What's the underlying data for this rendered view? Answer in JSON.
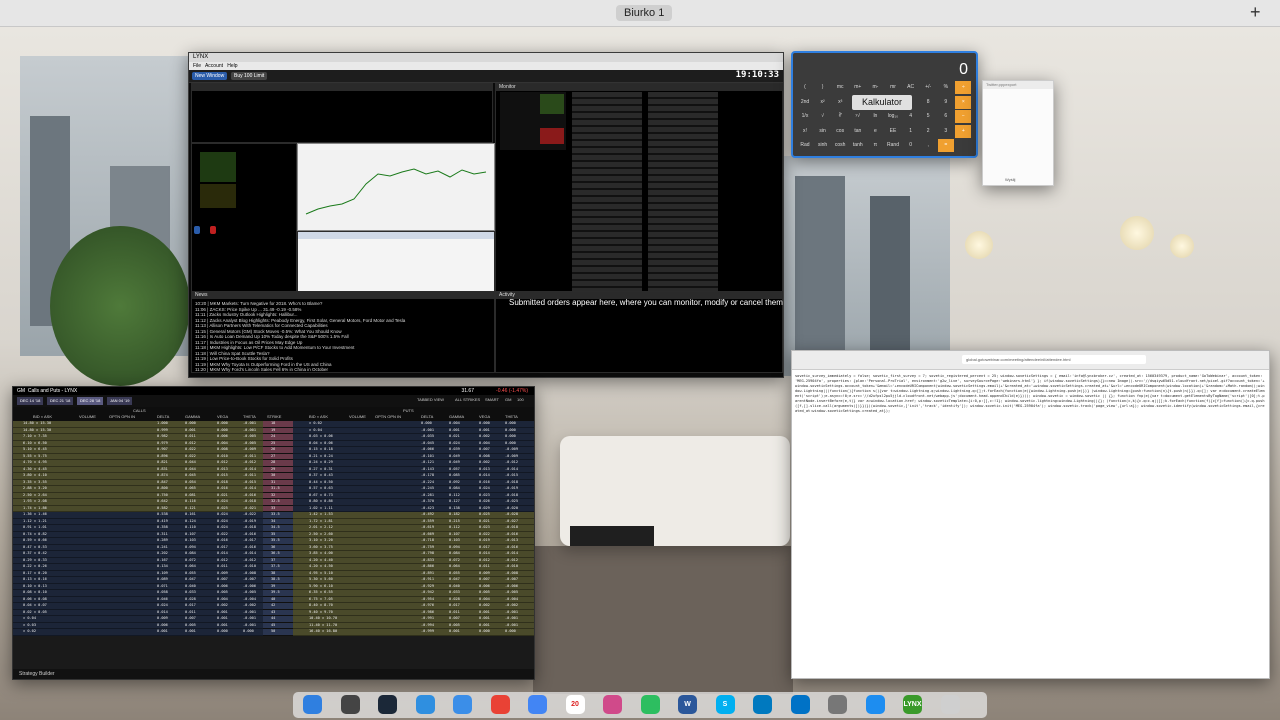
{
  "desktop": {
    "space_label": "Biurko 1",
    "add_space": "+"
  },
  "tws": {
    "title": "LYNX",
    "menu": [
      "File",
      "Account",
      "Help"
    ],
    "clock": "19:10:33",
    "order_bar": [
      "New Window",
      "Buy 100 Limit"
    ],
    "activity_message": "Submitted orders appear here, where you can monitor, modify or cancel them",
    "tabs": [
      "Monitor",
      "News",
      "Activity"
    ],
    "news_lines": [
      "10:20 | MKM Markets: Turn Negative for 2018. Who's to Blame?",
      "11:06 | ZACKS: Price Spike Up ... 31.49 -0.19 -0.58%",
      "11:11 | Zacks Industry Outlook Highlights: Hallibur...",
      "11:12 | Zacks Analyst Blog Highlights: Peabody Energy, First Solar, General Motors, Ford Motor and Tesla",
      "11:13 | Allison Partners With Telematics for Connected Capabilities",
      "11:15 | General Motors (GM) Stock Moves -0.5%: What You Should Know",
      "11:16 | Is Auto Loan Demand Up 10% Today despite the S&P 500's 1.5% Fall",
      "11:17 | Industries in Focus as Oil Prices May Edge Up",
      "11:18 | MKM Highlights: Low P/CF Stocks to Add Momentum to Your Investment",
      "11:18 | Will China Spat Scuttle Tesla?",
      "11:19 | Low Price-to-Book Stocks for Solid Profits",
      "11:19 | MKM Why Toyota Is Outperforming Ford in the US and China",
      "11:20 | MKM Why Ford's Lincoln Sales Fell 6% in China in October"
    ]
  },
  "calculator": {
    "display": "0",
    "tooltip": "Kalkulator",
    "keys": [
      "(",
      ")",
      "mc",
      "m+",
      "m-",
      "mr",
      "AC",
      "+/-",
      "%",
      "÷",
      "2nd",
      "x²",
      "x³",
      "xʸ",
      "eˣ",
      "10ˣ",
      "7",
      "8",
      "9",
      "×",
      "1/x",
      "√",
      "∛",
      "ʸ√",
      "ln",
      "log₁₀",
      "4",
      "5",
      "6",
      "−",
      "x!",
      "sin",
      "cos",
      "tan",
      "e",
      "EE",
      "1",
      "2",
      "3",
      "+",
      "Rad",
      "sinh",
      "cosh",
      "tanh",
      "π",
      "Rand",
      "0",
      ",",
      "="
    ]
  },
  "small_window": {
    "title": "Twitter.pppexport",
    "button": "Wyślij"
  },
  "browser": {
    "url": "global.gotowebinar.com/meeting/attendee/nil/attendee.html",
    "source": "sovetic_survey_immediately = false; sovetic_first_survey = 7; sovetic_registered_percent = 25; window.soveticSettings = { email:'info@lynxbroker.cz', created_at: 1560349379, product_name:'GoToWebinar', account_token: 'MEG-25904fa', properties: {plan:'Personal-ProTrial', environment:'g2w_live', surveySourcePage:'webinars.html'} }; if(window.soveticSettings){}==new Image().src='//dsqiyw65d51.cloudfront.net/pixel.gif?account_token='+window.soveticSettings.account_token+'&email='+encodeURIComponent(window.soveticSettings.email)+'&created_at='+window.soveticSettings.created_at+'&url='+encodeURIComponent(window.location)+'&random='+Math.random();window.Lightning||(function(){function s(){var t=window.Lightning.q;window.Lightning.q=[];t.forEach(function(e){window.Lightning.push(e)})} (window.Lightning={push:function(n){t.push(n)}}).q=[]; var e=document.createElement('script');e.async=!0;e.src='//d2ufpsl2pu5jjld.cloudfront.net/webapp.js';document.head.appendChild(e)})(); window.sovetic = window.sovetic || {}; function fnp(e){var t=document.getElementsByTagName('script')[0];t.parentNode.insertBefore(e,t)} var a=window.location.href; window.soveticTemplate={i:0,p:[],c:!1}; window.sovetic.lightning=window.Lightning||{}; (function(c,k){c.q=c.q||[];k.forEach(function(f){c[f]=function(){c.q.push([f,[].slice.call(arguments)])}})})(window.sovetic,['init','track','identify']); window.sovetic.init('MEG-25904fa'); window.sovetic.track('page_view',{url:a}); window.sovetic.identify(window.soveticSettings.email,{created_at:window.soveticSettings.created_at});"
  },
  "option_chain": {
    "title": "Calls and Puts - LYNX",
    "symbol": "GM",
    "last": "31.67",
    "change": "-0.46 (-1.47%)",
    "expiries": [
      "DEC 14 '18",
      "DEC 21 '18",
      "DEC 28 '18",
      "JAN 04 '19"
    ],
    "calls_label": "CALLS",
    "puts_label": "PUTS",
    "views": [
      "TABBED VIEW",
      "ALL STRIKES",
      "SMART",
      "GM",
      "100"
    ],
    "columns_calls": [
      "BID × ASK",
      "VOLUME",
      "OPTN OPN IN",
      "DELTA",
      "GAMMA",
      "VEGA",
      "THETA"
    ],
    "columns_puts": [
      "BID × ASK",
      "VOLUME",
      "OPTN OPN IN",
      "DELTA",
      "GAMMA",
      "VEGA",
      "THETA"
    ],
    "strike_label": "STRIKE",
    "footer": "Strategy Builder",
    "rows": [
      {
        "call": "14.80 × 15.30",
        "d": "1.000",
        "g": "0.000",
        "v": "0.000",
        "t": "-0.001",
        "k": "18",
        "put": "× 0.02",
        "pd": "0.000",
        "pg": "0.004",
        "pv": "0.000",
        "pt": "0.000"
      },
      {
        "call": "14.80 × 15.30",
        "d": "0.999",
        "g": "0.001",
        "v": "0.000",
        "t": "-0.001",
        "k": "19",
        "put": "× 0.04",
        "pd": "-0.001",
        "pg": "0.001",
        "pv": "0.001",
        "pt": "0.000"
      },
      {
        "call": "7.10 × 7.35",
        "d": "0.982",
        "g": "0.011",
        "v": "0.006",
        "t": "-0.005",
        "k": "24",
        "put": "0.03 × 0.06",
        "pd": "-0.035",
        "pg": "0.021",
        "pv": "0.002",
        "pt": "0.000"
      },
      {
        "call": "6.10 × 6.50",
        "d": "0.979",
        "g": "0.012",
        "v": "0.004",
        "t": "-0.005",
        "k": "25",
        "put": "0.04 × 0.06",
        "pd": "-0.045",
        "pg": "0.024",
        "pv": "0.004",
        "pt": "0.000"
      },
      {
        "call": "5.10 × 6.45",
        "d": "0.907",
        "g": "0.022",
        "v": "0.008",
        "t": "-0.009",
        "k": "26",
        "put": "0.15 × 0.18",
        "pd": "-0.066",
        "pg": "0.039",
        "pv": "0.007",
        "pt": "-0.009"
      },
      {
        "call": "5.55 × 5.75",
        "d": "0.896",
        "g": "0.022",
        "v": "0.010",
        "t": "-0.011",
        "k": "27",
        "put": "0.21 × 0.24",
        "pd": "-0.101",
        "pg": "0.049",
        "pv": "0.008",
        "pt": "-0.009"
      },
      {
        "call": "4.70 × 4.95",
        "d": "0.821",
        "g": "0.044",
        "v": "0.012",
        "t": "-0.012",
        "k": "28",
        "put": "0.24 × 0.29",
        "pd": "-0.121",
        "pg": "0.049",
        "pv": "0.002",
        "pt": "-0.012"
      },
      {
        "call": "4.30 × 4.45",
        "d": "0.831",
        "g": "0.044",
        "v": "0.013",
        "t": "-0.014",
        "k": "29",
        "put": "0.27 × 0.31",
        "pd": "-0.143",
        "pg": "0.057",
        "pv": "0.013",
        "pt": "-0.014"
      },
      {
        "call": "3.80 × 4.10",
        "d": "0.874",
        "g": "0.045",
        "v": "0.015",
        "t": "-0.011",
        "k": "30",
        "put": "0.37 × 0.43",
        "pd": "-0.178",
        "pg": "0.085",
        "pv": "0.014",
        "pt": "-0.015"
      },
      {
        "call": "3.35 × 3.55",
        "d": "0.847",
        "g": "0.054",
        "v": "0.018",
        "t": "-0.015",
        "k": "31",
        "put": "0.44 × 0.50",
        "pd": "-0.224",
        "pg": "0.092",
        "pv": "0.016",
        "pt": "-0.018"
      },
      {
        "call": "2.88 × 3.20",
        "d": "0.800",
        "g": "0.065",
        "v": "0.016",
        "t": "-0.014",
        "k": "31.5",
        "put": "0.57 × 0.63",
        "pd": "-0.245",
        "pg": "0.084",
        "pv": "0.024",
        "pt": "-0.019"
      },
      {
        "call": "2.50 × 2.64",
        "d": "0.750",
        "g": "0.081",
        "v": "0.021",
        "t": "-0.016",
        "k": "32",
        "put": "0.67 × 0.73",
        "pd": "-0.281",
        "pg": "0.112",
        "pv": "0.023",
        "pt": "-0.018"
      },
      {
        "call": "1.93 × 2.08",
        "d": "0.642",
        "g": "0.116",
        "v": "0.024",
        "t": "-0.018",
        "k": "32.5",
        "put": "0.80 × 0.86",
        "pd": "-0.370",
        "pg": "0.127",
        "pv": "0.026",
        "pt": "-0.025"
      },
      {
        "call": "1.74 × 1.86",
        "d": "0.582",
        "g": "0.121",
        "v": "0.025",
        "t": "-0.021",
        "k": "33",
        "put": "1.02 × 1.11",
        "pd": "-0.423",
        "pg": "0.138",
        "pv": "0.029",
        "pt": "-0.020"
      },
      {
        "call": "1.36 × 1.46",
        "d": "0.538",
        "g": "0.161",
        "v": "0.024",
        "t": "-0.022",
        "k": "33.5",
        "put": "1.42 × 1.53",
        "pd": "-0.492",
        "pg": "0.182",
        "pv": "0.025",
        "pt": "-0.028"
      },
      {
        "call": "1.12 × 1.21",
        "d": "0.419",
        "g": "0.124",
        "v": "0.024",
        "t": "-0.019",
        "k": "34",
        "put": "1.72 × 1.81",
        "pd": "-0.559",
        "pg": "0.215",
        "pv": "0.021",
        "pt": "-0.027"
      },
      {
        "call": "0.91 × 1.01",
        "d": "0.358",
        "g": "0.110",
        "v": "0.024",
        "t": "-0.018",
        "k": "34.5",
        "put": "2.01 × 2.12",
        "pd": "-0.619",
        "pg": "0.112",
        "pv": "0.023",
        "pt": "-0.018"
      },
      {
        "call": "0.74 × 0.82",
        "d": "0.311",
        "g": "0.107",
        "v": "0.022",
        "t": "-0.016",
        "k": "35",
        "put": "2.50 × 2.60",
        "pd": "-0.669",
        "pg": "0.107",
        "pv": "0.022",
        "pt": "-0.016"
      },
      {
        "call": "0.59 × 0.66",
        "d": "0.289",
        "g": "0.103",
        "v": "0.016",
        "t": "-0.017",
        "k": "35.5",
        "put": "3.10 × 3.20",
        "pd": "-0.718",
        "pg": "0.103",
        "pv": "0.019",
        "pt": "-0.013"
      },
      {
        "call": "0.47 × 0.53",
        "d": "0.241",
        "g": "0.094",
        "v": "0.017",
        "t": "-0.016",
        "k": "36",
        "put": "3.60 × 3.75",
        "pd": "-0.759",
        "pg": "0.094",
        "pv": "0.017",
        "pt": "-0.016"
      },
      {
        "call": "0.37 × 0.42",
        "d": "0.202",
        "g": "0.084",
        "v": "0.014",
        "t": "-0.014",
        "k": "36.5",
        "put": "3.85 × 4.00",
        "pd": "-0.798",
        "pg": "0.084",
        "pv": "0.014",
        "pt": "-0.014"
      },
      {
        "call": "0.29 × 0.33",
        "d": "0.167",
        "g": "0.072",
        "v": "0.012",
        "t": "-0.012",
        "k": "37",
        "put": "4.20 × 4.40",
        "pd": "-0.833",
        "pg": "0.072",
        "pv": "0.012",
        "pt": "-0.012"
      },
      {
        "call": "0.22 × 0.26",
        "d": "0.134",
        "g": "0.064",
        "v": "0.011",
        "t": "-0.010",
        "k": "37.5",
        "put": "4.20 × 4.50",
        "pd": "-0.866",
        "pg": "0.064",
        "pv": "0.011",
        "pt": "-0.010"
      },
      {
        "call": "0.17 × 0.20",
        "d": "0.109",
        "g": "0.055",
        "v": "0.009",
        "t": "-0.008",
        "k": "38",
        "put": "4.95 × 5.10",
        "pd": "-0.891",
        "pg": "0.055",
        "pv": "0.009",
        "pt": "-0.008"
      },
      {
        "call": "0.13 × 0.16",
        "d": "0.089",
        "g": "0.047",
        "v": "0.007",
        "t": "-0.007",
        "k": "38.5",
        "put": "5.30 × 5.60",
        "pd": "-0.911",
        "pg": "0.047",
        "pv": "0.007",
        "pt": "-0.007"
      },
      {
        "call": "0.10 × 0.13",
        "d": "0.071",
        "g": "0.040",
        "v": "0.006",
        "t": "-0.006",
        "k": "39",
        "put": "5.90 × 6.10",
        "pd": "-0.929",
        "pg": "0.040",
        "pv": "0.006",
        "pt": "-0.006"
      },
      {
        "call": "0.08 × 0.10",
        "d": "0.058",
        "g": "0.033",
        "v": "0.005",
        "t": "-0.005",
        "k": "39.5",
        "put": "6.35 × 6.55",
        "pd": "-0.942",
        "pg": "0.033",
        "pv": "0.005",
        "pt": "-0.005"
      },
      {
        "call": "0.06 × 0.08",
        "d": "0.046",
        "g": "0.028",
        "v": "0.004",
        "t": "-0.004",
        "k": "40",
        "put": "6.75 × 7.05",
        "pd": "-0.954",
        "pg": "0.028",
        "pv": "0.004",
        "pt": "-0.004"
      },
      {
        "call": "0.04 × 0.07",
        "d": "0.024",
        "g": "0.017",
        "v": "0.002",
        "t": "-0.002",
        "k": "42",
        "put": "8.40 × 8.70",
        "pd": "-0.976",
        "pg": "0.017",
        "pv": "0.002",
        "pt": "-0.002"
      },
      {
        "call": "0.02 × 0.05",
        "d": "0.014",
        "g": "0.011",
        "v": "0.001",
        "t": "-0.001",
        "k": "43",
        "put": "9.40 × 9.70",
        "pd": "-0.986",
        "pg": "0.011",
        "pv": "0.001",
        "pt": "-0.001"
      },
      {
        "call": "× 0.04",
        "d": "0.009",
        "g": "0.007",
        "v": "0.001",
        "t": "-0.001",
        "k": "44",
        "put": "10.40 × 10.70",
        "pd": "-0.991",
        "pg": "0.007",
        "pv": "0.001",
        "pt": "-0.001"
      },
      {
        "call": "× 0.03",
        "d": "0.006",
        "g": "0.005",
        "v": "0.001",
        "t": "-0.001",
        "k": "45",
        "put": "11.40 × 11.70",
        "pd": "-0.994",
        "pg": "0.005",
        "pv": "0.001",
        "pt": "-0.001"
      },
      {
        "call": "× 0.02",
        "d": "0.001",
        "g": "0.001",
        "v": "0.000",
        "t": "0.000",
        "k": "50",
        "put": "16.40 × 16.80",
        "pd": "-0.999",
        "pg": "0.001",
        "pv": "0.000",
        "pt": "0.000"
      }
    ]
  },
  "dock": {
    "apps": [
      {
        "name": "finder",
        "label": "",
        "color": "#2f7fe0"
      },
      {
        "name": "launchpad",
        "label": "",
        "color": "#444"
      },
      {
        "name": "steam",
        "label": "",
        "color": "#1b2838"
      },
      {
        "name": "safari",
        "label": "",
        "color": "#2f8fe0"
      },
      {
        "name": "mail",
        "label": "",
        "color": "#3b8ee8"
      },
      {
        "name": "chrome",
        "label": "",
        "color": "#e94235"
      },
      {
        "name": "notes",
        "label": "",
        "color": "#4285f4"
      },
      {
        "name": "calendar",
        "label": "20",
        "color": "#ffffff"
      },
      {
        "name": "photos",
        "label": "",
        "color": "#d04a8a"
      },
      {
        "name": "evernote",
        "label": "",
        "color": "#2dbe60"
      },
      {
        "name": "word",
        "label": "W",
        "color": "#2b579a"
      },
      {
        "name": "skype",
        "label": "S",
        "color": "#00aff0"
      },
      {
        "name": "trello",
        "label": "",
        "color": "#0079bf"
      },
      {
        "name": "outlook",
        "label": "",
        "color": "#0072c6"
      },
      {
        "name": "system-preferences",
        "label": "",
        "color": "#777"
      },
      {
        "name": "app-store",
        "label": "",
        "color": "#1d8df0"
      },
      {
        "name": "lynx",
        "label": "LYNX",
        "color": "#3a9a2a"
      },
      {
        "name": "trash",
        "label": "",
        "color": "#cfcfcf"
      }
    ]
  }
}
